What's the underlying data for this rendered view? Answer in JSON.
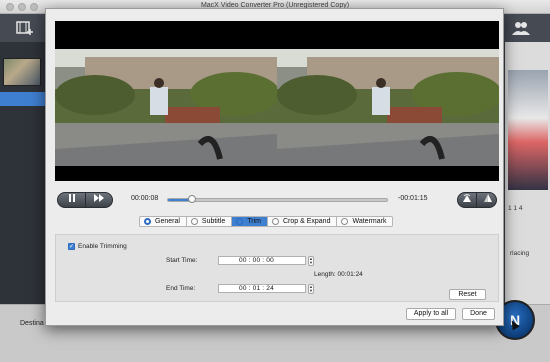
{
  "app": {
    "title": "MacX Video Converter Pro (Unregistered Copy)",
    "bottom_label": "Destina",
    "run_label": "N",
    "right_pane_text": "1 1 4",
    "right_pane_text2": "rlacing"
  },
  "dialog": {
    "playback": {
      "pause_icon": "pause-icon",
      "forward_icon": "fast-forward-icon",
      "current_time": "00:00:08",
      "remaining_time": "-00:01:15",
      "progress": 0.11,
      "rotate_icon": "rotate-icon",
      "flip_icon": "flip-icon"
    },
    "tabs": [
      {
        "label": "General",
        "active": false,
        "selected": true
      },
      {
        "label": "Subtitle",
        "active": false,
        "selected": false
      },
      {
        "label": "Trim",
        "active": true,
        "selected": false
      },
      {
        "label": "Crop & Expand",
        "active": false,
        "selected": false
      },
      {
        "label": "Watermark",
        "active": false,
        "selected": false
      }
    ],
    "trim": {
      "enable_label": "Enable Trimming",
      "enable_checked": true,
      "start_label": "Start Time:",
      "start_value": "00 : 00 : 00",
      "end_label": "End Time:",
      "end_value": "00 : 01 : 24",
      "length_label": "Length:",
      "length_value": "00:01:24",
      "reset_label": "Reset"
    },
    "apply_label": "Apply to all",
    "done_label": "Done"
  },
  "colors": {
    "accent": "#3f7fd0",
    "dialog_bg": "#ececec",
    "app_bg": "#3b3f47"
  }
}
